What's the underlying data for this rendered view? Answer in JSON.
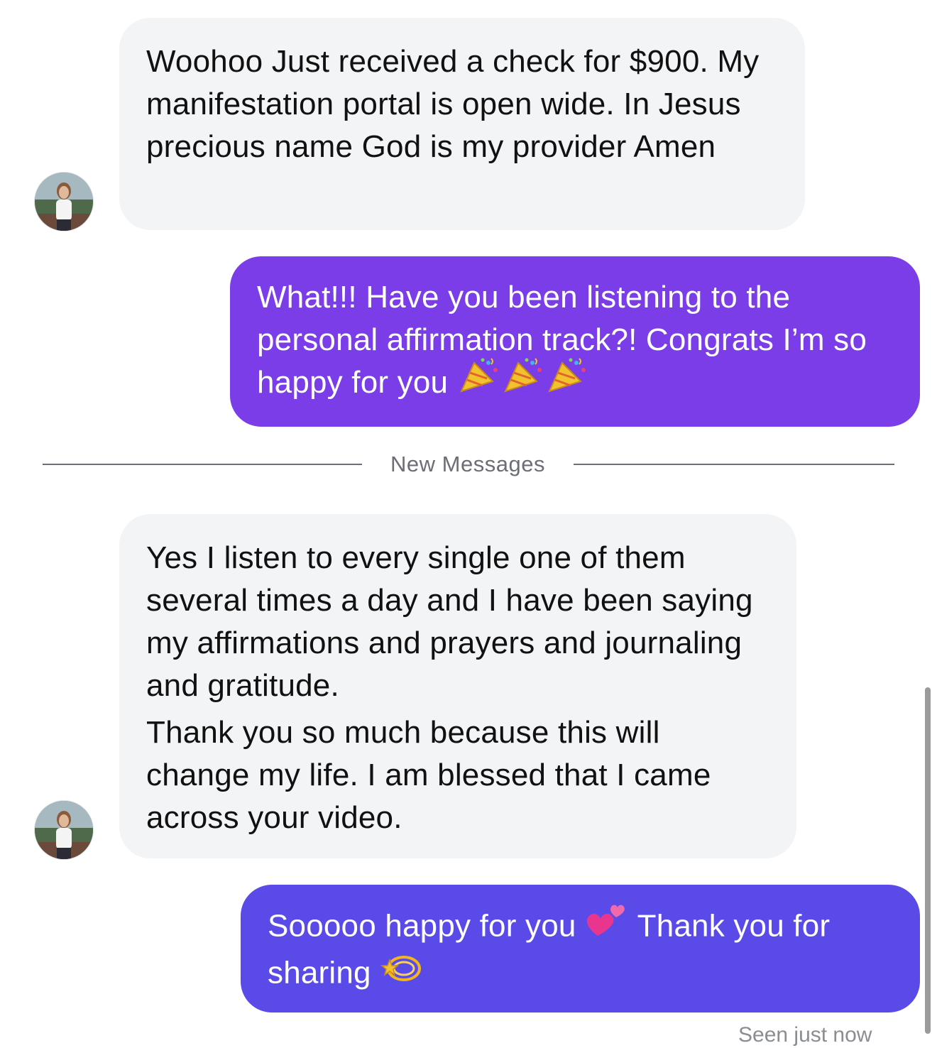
{
  "colors": {
    "incoming_bubble": "#f3f4f6",
    "outgoing_bubble_1": "#7a3de8",
    "outgoing_bubble_2": "#5a4be8",
    "divider": "#6b6f75"
  },
  "messages": [
    {
      "direction": "incoming",
      "paragraphs": [
        "Woohoo Just received a check for $900. My manifestation portal is open wide. In Jesus precious name God is my provider Amen"
      ]
    },
    {
      "direction": "outgoing",
      "text": "What!!! Have you been listening to the personal affirmation track?! Congrats I’m so happy for you",
      "emojis": [
        "party-popper-icon",
        "party-popper-icon",
        "party-popper-icon"
      ]
    },
    {
      "direction": "incoming",
      "paragraphs": [
        "Yes I listen to every single one of them several times a day and I have been saying my affirmations and prayers and journaling and gratitude.",
        "Thank you so much because this will change my life. I am blessed that I came across your video."
      ]
    },
    {
      "direction": "outgoing",
      "text_before": "Sooooo happy for you",
      "text_middle": "Thank you for sharing",
      "emojis": [
        "two-hearts-icon",
        "dizzy-star-icon"
      ]
    }
  ],
  "divider": {
    "label": "New Messages"
  },
  "status": "Seen just now"
}
